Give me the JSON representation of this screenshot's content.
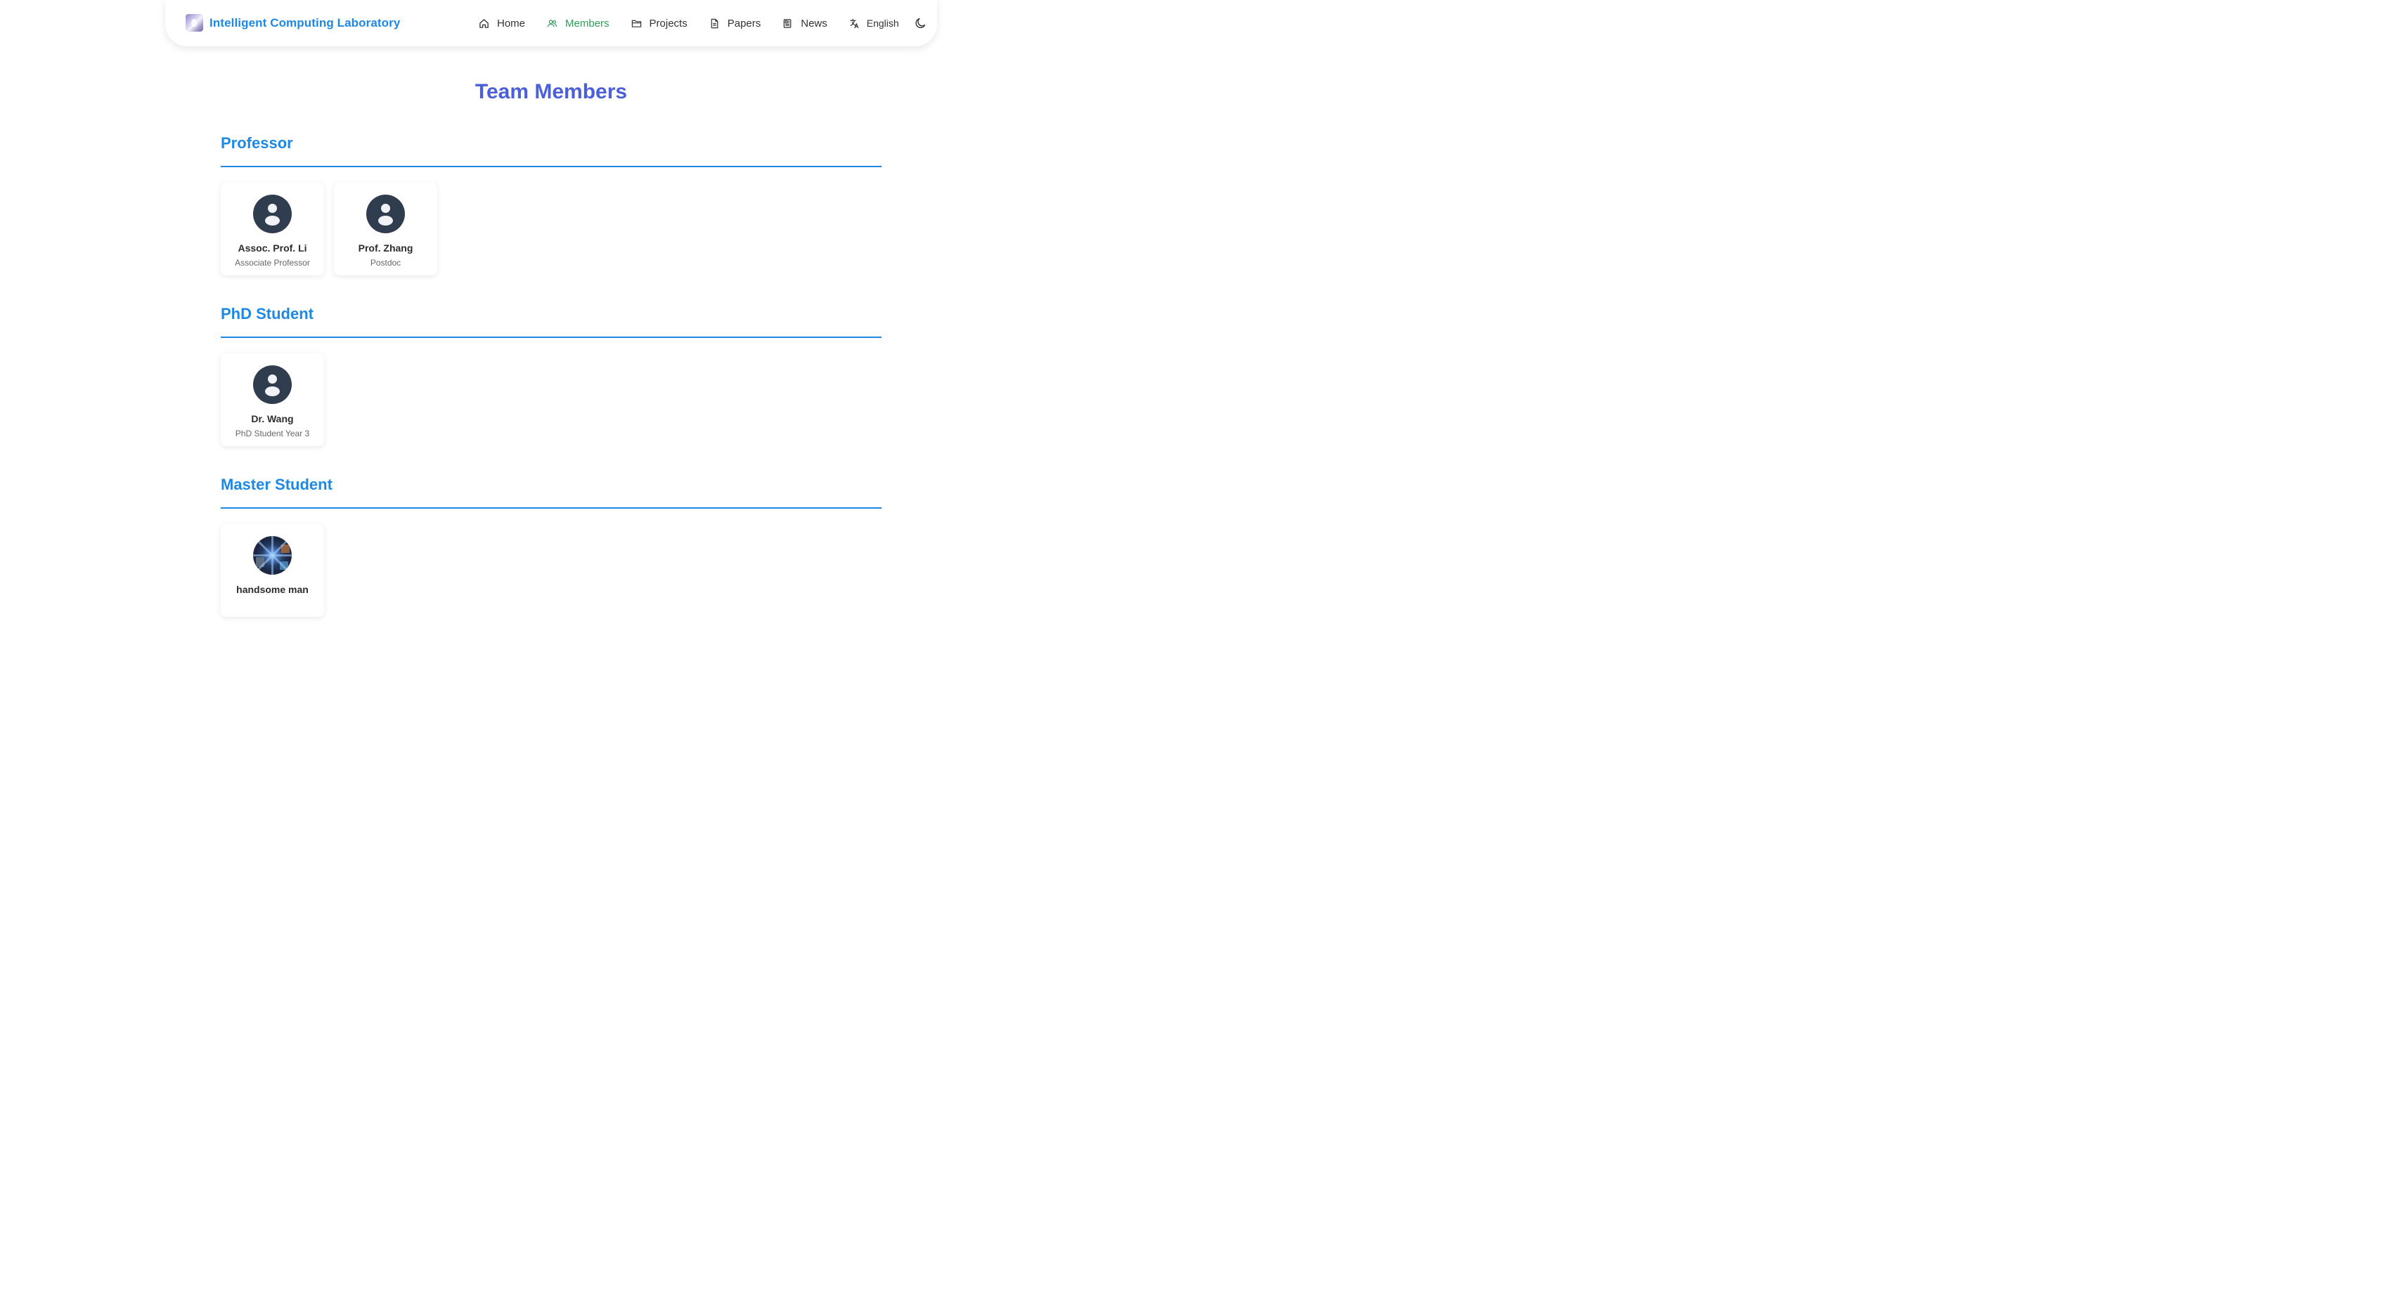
{
  "header": {
    "brand": {
      "logo_icon": "lab-logo-icon",
      "title": "Intelligent Computing Laboratory"
    },
    "nav": [
      {
        "label": "Home",
        "icon": "home-icon",
        "active": false
      },
      {
        "label": "Members",
        "icon": "users-icon",
        "active": true
      },
      {
        "label": "Projects",
        "icon": "folder-icon",
        "active": false
      },
      {
        "label": "Papers",
        "icon": "document-icon",
        "active": false
      },
      {
        "label": "News",
        "icon": "newspaper-icon",
        "active": false
      }
    ],
    "language": {
      "label": "English",
      "icon": "translate-icon"
    },
    "theme_toggle_icon": "moon-icon"
  },
  "main": {
    "title": "Team Members",
    "sections": [
      {
        "title": "Professor",
        "members": [
          {
            "name": "Assoc. Prof. Li",
            "role": "Associate Professor",
            "avatar": "default-avatar-icon"
          },
          {
            "name": "Prof. Zhang",
            "role": "Postdoc",
            "avatar": "default-avatar-icon"
          }
        ]
      },
      {
        "title": "PhD Student",
        "members": [
          {
            "name": "Dr. Wang",
            "role": "PhD Student Year 3",
            "avatar": "default-avatar-icon"
          }
        ]
      },
      {
        "title": "Master Student",
        "members": [
          {
            "name": "handsome man",
            "role": "",
            "avatar": "photo-avatar"
          }
        ]
      }
    ]
  },
  "colors": {
    "brand_blue": "#1e88e5",
    "title_blue": "#4a5fd8",
    "active_green": "#2e9e57",
    "avatar_dark": "#2f3d4f"
  }
}
